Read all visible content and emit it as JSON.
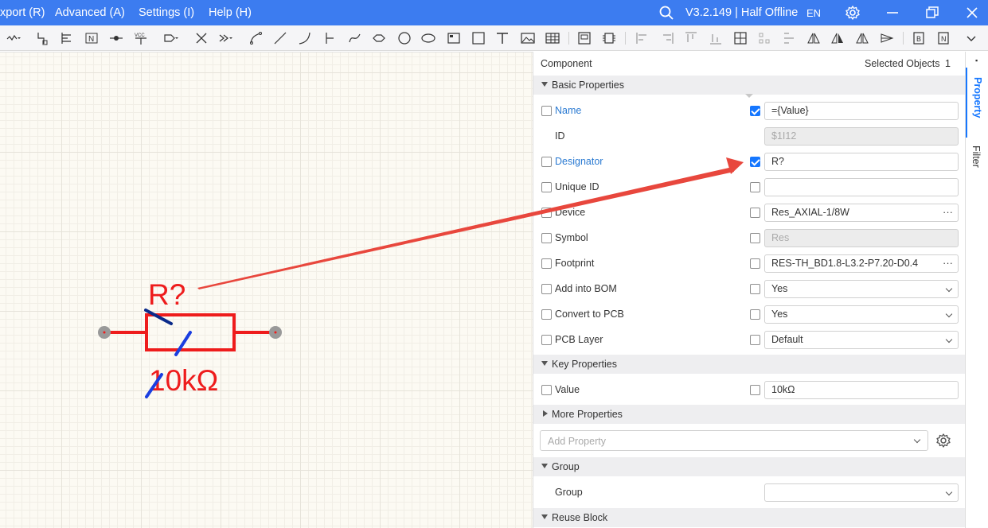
{
  "menu": {
    "export": "xport (R)",
    "advanced": "Advanced (A)",
    "settings": "Settings (I)",
    "help": "Help (H)"
  },
  "titlebar": {
    "version": "V3.2.149 | Half Offline",
    "language": "EN"
  },
  "schematic": {
    "designator": "R?",
    "value": "10kΩ"
  },
  "panel": {
    "title": "Component",
    "selected_label": "Selected Objects",
    "selected_count": "1",
    "sections": {
      "basic": "Basic Properties",
      "key": "Key Properties",
      "more": "More Properties",
      "group": "Group",
      "reuse": "Reuse Block"
    },
    "rows": {
      "name": {
        "label": "Name",
        "value": "={Value}"
      },
      "id": {
        "label": "ID",
        "value": "$1I12"
      },
      "designator": {
        "label": "Designator",
        "value": "R?"
      },
      "unique_id": {
        "label": "Unique ID",
        "value": ""
      },
      "device": {
        "label": "Device",
        "value": "Res_AXIAL-1/8W"
      },
      "symbol": {
        "label": "Symbol",
        "value": "Res"
      },
      "footprint": {
        "label": "Footprint",
        "value": "RES-TH_BD1.8-L3.2-P7.20-D0.4"
      },
      "add_bom": {
        "label": "Add into BOM",
        "value": "Yes"
      },
      "convert_pcb": {
        "label": "Convert to PCB",
        "value": "Yes"
      },
      "pcb_layer": {
        "label": "PCB Layer",
        "value": "Default"
      },
      "value": {
        "label": "Value",
        "value": "10kΩ"
      },
      "group": {
        "label": "Group",
        "value": ""
      }
    },
    "add_property_placeholder": "Add Property",
    "more_dots": "···"
  },
  "side_tabs": {
    "property": "Property",
    "filter": "Filter"
  },
  "colors": {
    "titlebar": "#3c7cf0",
    "accent": "#1677ff",
    "annotation_arrow": "#e8473d",
    "schematic_red": "#ee1c1c",
    "strike_blue": "#1a3ee0"
  }
}
